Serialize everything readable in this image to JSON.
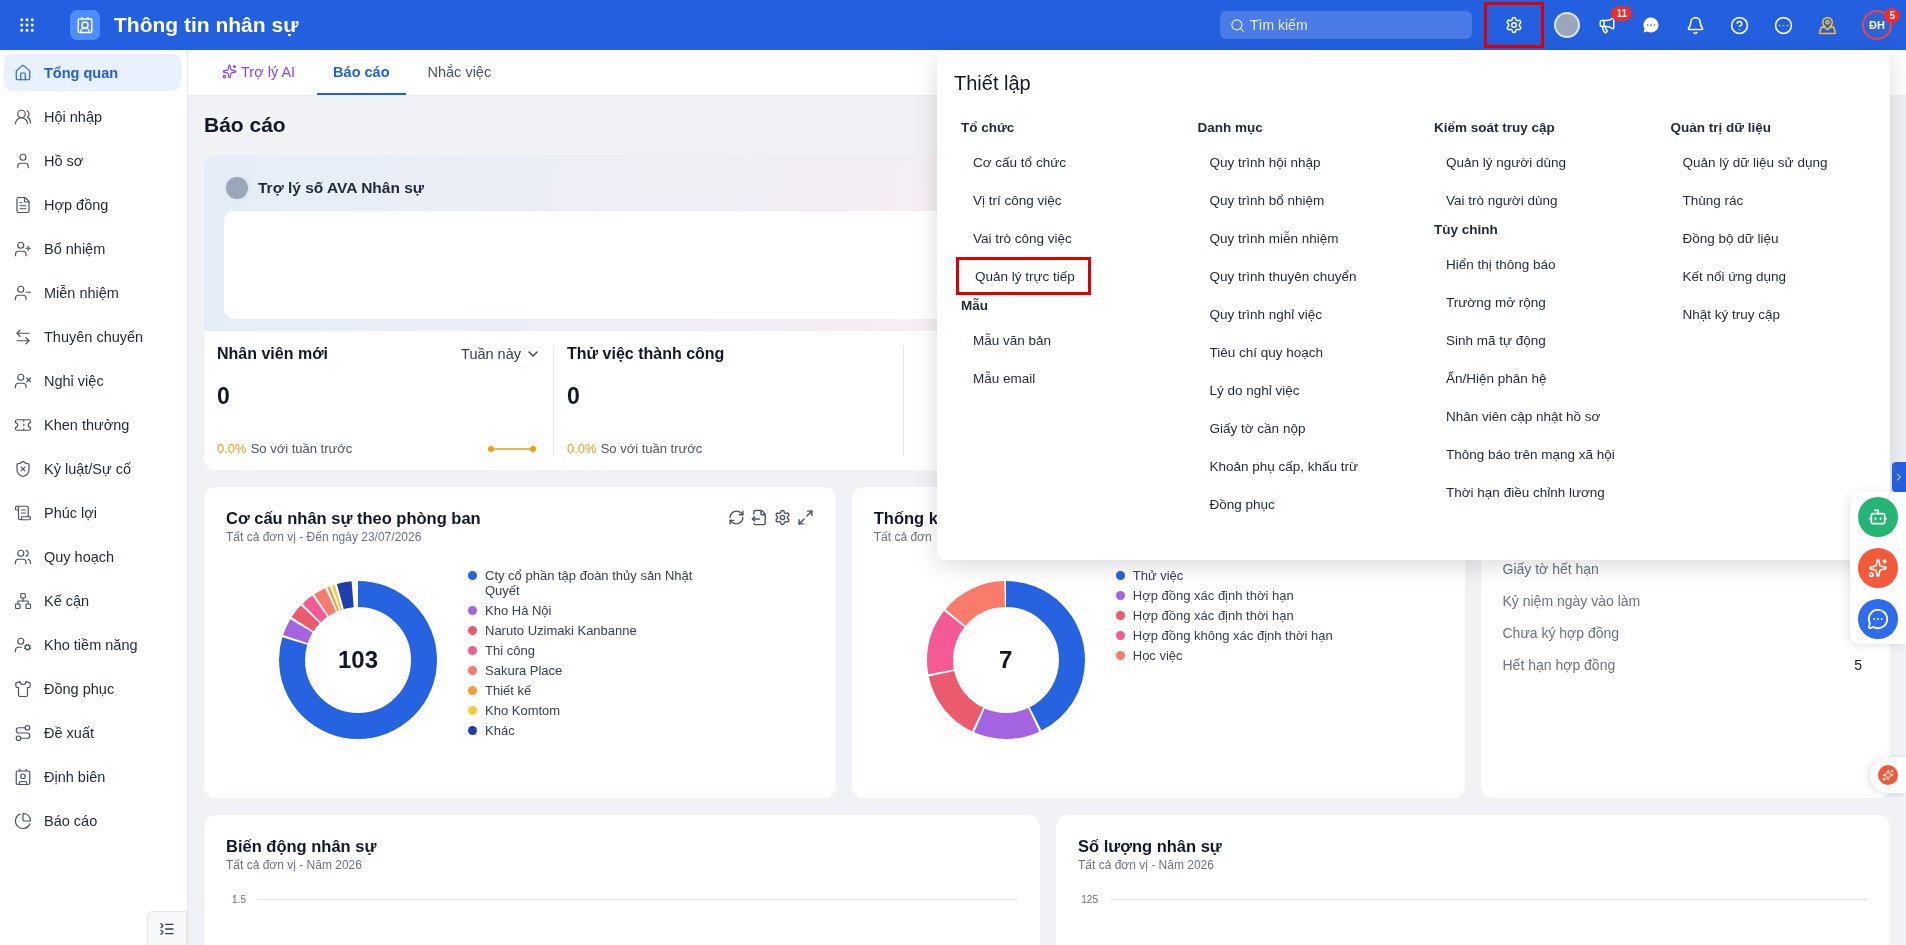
{
  "topbar": {
    "app_title": "Thông tin nhân sự",
    "search": {
      "placeholder": "Tìm kiếm"
    },
    "settings_highlighted": true,
    "announcement_badge": "11",
    "user": {
      "initials": "ĐH",
      "badge": "5"
    }
  },
  "sidebar": {
    "items": [
      {
        "label": "Tổng quan",
        "selected": true
      },
      {
        "label": "Hội nhập",
        "selected": false
      },
      {
        "label": "Hồ sơ",
        "selected": false
      },
      {
        "label": "Hợp đồng",
        "selected": false
      },
      {
        "label": "Bổ nhiệm",
        "selected": false
      },
      {
        "label": "Miễn nhiệm",
        "selected": false
      },
      {
        "label": "Thuyên chuyển",
        "selected": false
      },
      {
        "label": "Nghỉ việc",
        "selected": false
      },
      {
        "label": "Khen thưởng",
        "selected": false
      },
      {
        "label": "Kỷ luật/Sự cố",
        "selected": false
      },
      {
        "label": "Phúc lợi",
        "selected": false
      },
      {
        "label": "Quy hoạch",
        "selected": false
      },
      {
        "label": "Kế cận",
        "selected": false
      },
      {
        "label": "Kho tiềm năng",
        "selected": false
      },
      {
        "label": "Đồng phục",
        "selected": false
      },
      {
        "label": "Đề xuất",
        "selected": false
      },
      {
        "label": "Định biên",
        "selected": false
      },
      {
        "label": "Báo cáo",
        "selected": false
      }
    ]
  },
  "tabs": [
    {
      "label": "Trợ lý AI",
      "kind": "ai",
      "selected": false
    },
    {
      "label": "Báo cáo",
      "kind": "plain",
      "selected": true
    },
    {
      "label": "Nhắc việc",
      "kind": "plain",
      "selected": false
    }
  ],
  "page_title": "Báo cáo",
  "assistant": {
    "title": "Trợ lý số AVA Nhân sự"
  },
  "stats": [
    {
      "title": "Nhân viên mới",
      "period": "Tuần này",
      "value": "0",
      "change": "0.0%",
      "compare": "So với tuần trước",
      "sparkline": true
    },
    {
      "title": "Thử việc thành công",
      "value": "0",
      "change": "0.0%",
      "compare": "So với tuần trước",
      "sparkline": false
    }
  ],
  "department_chart": {
    "title": "Cơ cấu nhân sự theo phòng ban",
    "subtitle": "Tất cả đơn vị - Đến ngày 23/07/2026",
    "total": "103",
    "legend": [
      {
        "label": "Cty cổ phần tập đoàn thủy sản Nhật Quyết",
        "color": "#2563e0"
      },
      {
        "label": "Kho Hà Nội",
        "color": "#a463e0"
      },
      {
        "label": "Naruto Uzimaki Kanbanne",
        "color": "#ec5a6e"
      },
      {
        "label": "Thi công",
        "color": "#f55a94"
      },
      {
        "label": "Sakura Place",
        "color": "#f87b6b"
      },
      {
        "label": "Thiết kế",
        "color": "#fb9a3c"
      },
      {
        "label": "Kho Komtom",
        "color": "#fbc933"
      },
      {
        "label": "Khác",
        "color": "#1e40af"
      }
    ]
  },
  "contract_chart": {
    "title": "Thống k",
    "subtitle": "Tất cả đơn",
    "total": "7",
    "legend": [
      {
        "label": "Thử việc",
        "color": "#2563e0"
      },
      {
        "label": "Hợp đồng xác định thời hạn",
        "color": "#a463e0"
      },
      {
        "label": "Hợp đồng xác định thời hạn",
        "color": "#ec5a6e"
      },
      {
        "label": "Hợp đồng không xác định thời hạn",
        "color": "#f55a94"
      },
      {
        "label": "Học việc",
        "color": "#f87b6b"
      }
    ]
  },
  "reminders": [
    {
      "label": "Giấy tờ hết hạn"
    },
    {
      "label": "Kỷ niệm ngày vào làm"
    },
    {
      "label": "Chưa ký hợp đồng"
    },
    {
      "label": "Hết hạn hợp đồng",
      "value": "5"
    }
  ],
  "trend_charts": [
    {
      "title": "Biến động nhân sự",
      "subtitle": "Tất cả đơn vị - Năm 2026",
      "top_tick": "1.5"
    },
    {
      "title": "Số lượng nhân sự",
      "subtitle": "Tất cả đơn vị - Năm 2026",
      "top_tick": "125"
    }
  ],
  "settings_menu": {
    "title": "Thiết lập",
    "columns": [
      {
        "groups": [
          {
            "heading": "Tổ chức",
            "items": [
              {
                "label": "Cơ cấu tổ chức",
                "highlighted": false
              },
              {
                "label": "Vị trí công việc",
                "highlighted": false
              },
              {
                "label": "Vai trò công việc",
                "highlighted": false
              },
              {
                "label": "Quản lý trực tiếp",
                "highlighted": true
              }
            ]
          },
          {
            "heading": "Mẫu",
            "items": [
              {
                "label": "Mẫu văn bản",
                "highlighted": false
              },
              {
                "label": "Mẫu email",
                "highlighted": false
              }
            ]
          }
        ]
      },
      {
        "groups": [
          {
            "heading": "Danh mục",
            "items": [
              {
                "label": "Quy trình hội nhập",
                "highlighted": false
              },
              {
                "label": "Quy trình bổ nhiệm",
                "highlighted": false
              },
              {
                "label": "Quy trình miễn nhiệm",
                "highlighted": false
              },
              {
                "label": "Quy trình thuyên chuyển",
                "highlighted": false
              },
              {
                "label": "Quy trình nghỉ việc",
                "highlighted": false
              },
              {
                "label": "Tiêu chí quy hoạch",
                "highlighted": false
              },
              {
                "label": "Lý do nghỉ việc",
                "highlighted": false
              },
              {
                "label": "Giấy tờ cần nộp",
                "highlighted": false
              },
              {
                "label": "Khoản phụ cấp, khấu trừ",
                "highlighted": false
              },
              {
                "label": "Đồng phục",
                "highlighted": false
              }
            ]
          }
        ]
      },
      {
        "groups": [
          {
            "heading": "Kiểm soát truy cập",
            "items": [
              {
                "label": "Quản lý người dùng",
                "highlighted": false
              },
              {
                "label": "Vai trò người dùng",
                "highlighted": false
              }
            ]
          },
          {
            "heading": "Tùy chỉnh",
            "items": [
              {
                "label": "Hiển thị thông báo",
                "highlighted": false
              },
              {
                "label": "Trường mở rộng",
                "highlighted": false
              },
              {
                "label": "Sinh mã tự động",
                "highlighted": false
              },
              {
                "label": "Ẩn/Hiện phân hệ",
                "highlighted": false
              },
              {
                "label": "Nhân viên cập nhật hồ sơ",
                "highlighted": false
              },
              {
                "label": "Thông báo trên mạng xã hội",
                "highlighted": false
              },
              {
                "label": "Thời hạn điều chỉnh lương",
                "highlighted": false
              }
            ]
          }
        ]
      },
      {
        "groups": [
          {
            "heading": "Quản trị dữ liệu",
            "items": [
              {
                "label": "Quản lý dữ liệu sử dụng",
                "highlighted": false
              },
              {
                "label": "Thùng rác",
                "highlighted": false
              },
              {
                "label": "Đồng bộ dữ liệu",
                "highlighted": false
              },
              {
                "label": "Kết nối ứng dụng",
                "highlighted": false
              },
              {
                "label": "Nhật ký truy cập",
                "highlighted": false
              }
            ]
          }
        ]
      }
    ]
  }
}
